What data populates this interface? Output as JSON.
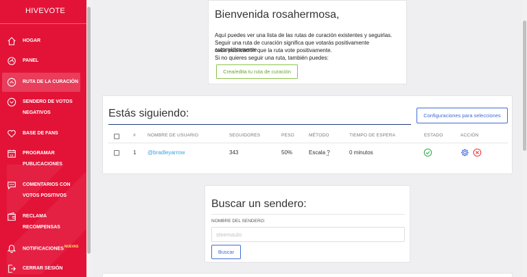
{
  "sidebar": {
    "brand": "HIVEVOTE",
    "items": [
      {
        "label": "HOGAR",
        "icon": "home-icon"
      },
      {
        "label": "PANEL",
        "icon": "dashboard-icon"
      },
      {
        "label": "RUTA DE LA CURACIÓN",
        "icon": "chevron-up-circle-icon"
      },
      {
        "label": "SENDERO DE VOTOS",
        "label2": "NEGATIVOS",
        "icon": "chevron-down-circle-icon"
      },
      {
        "label": "BASE DE FANS",
        "icon": "heart-icon"
      },
      {
        "label": "PROGRAMAR",
        "label2": "PUBLICACIONES",
        "icon": "calendar-icon"
      },
      {
        "label": "COMENTARIOS CON",
        "label2": "VOTOS POSITIVOS",
        "icon": "comment-icon"
      },
      {
        "label": "RECLAMA",
        "label2": "RECOMPENSAS",
        "icon": "wallet-icon"
      },
      {
        "label": "NOTIFICACIONES",
        "badge": "NUEVAS",
        "icon": "bell-icon"
      },
      {
        "label": "CERRAR SESIÓN",
        "icon": "logout-icon"
      }
    ]
  },
  "welcome": {
    "title": "Bienvenida rosahermosa,",
    "line1": "Aquí puedes ver una lista de las rutas de curación existentes y seguirlas.",
    "line2": "Seguir una ruta de curación significa que votarás positivamente automáticamente",
    "line3": "cada publicación que la ruta vote positivamente.",
    "line4": "Si no quieres seguir una ruta, también puedes:",
    "button": "Crea/edita tu ruta de curación"
  },
  "following": {
    "title": "Estás siguiendo:",
    "config_button": "Configuraciones para selecciones",
    "headers": [
      "#",
      "NOMBRE DE USUARIO",
      "SEGUIDORES",
      "PESO",
      "MÉTODO",
      "TIEMPO DE ESPERA",
      "ESTADO",
      "ACCIÓN"
    ],
    "rows": [
      {
        "num": "1",
        "user": "@bradleyarrow",
        "followers": "343",
        "weight": "50%",
        "method": "Escala",
        "method_help": "?",
        "wait": "0 minutos",
        "status_icon": "check-circle-icon"
      }
    ]
  },
  "search": {
    "title": "Buscar un sendero:",
    "label": "NOMBRE DEL SENDERO:",
    "placeholder": "steemauto",
    "button": "Buscar"
  },
  "colors": {
    "sidebar": "#e31337",
    "accent_blue": "#3f6ad8",
    "green": "#8bc34a",
    "link": "#3aa0e0",
    "danger": "#e53935"
  }
}
